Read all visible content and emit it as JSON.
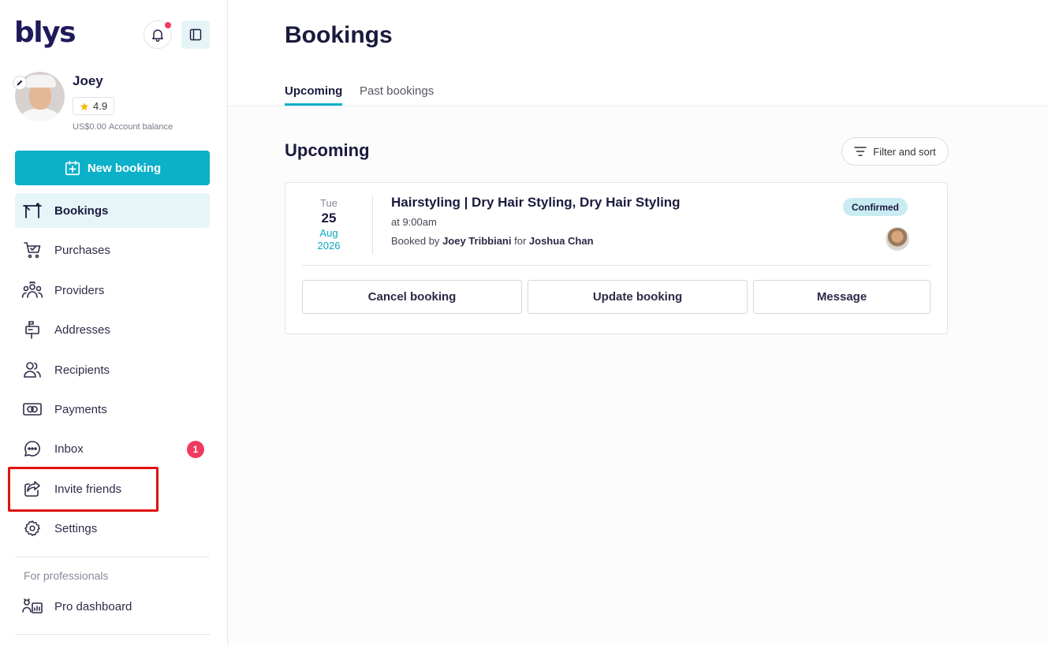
{
  "app": {
    "logo": "blys"
  },
  "profile": {
    "name": "Joey",
    "rating": "4.9",
    "balance_amount": "US$0.00",
    "balance_label": "Account balance"
  },
  "sidebar": {
    "new_booking_label": "New booking",
    "items": [
      {
        "label": "Bookings",
        "icon": "bookings-icon",
        "active": true
      },
      {
        "label": "Purchases",
        "icon": "cart-icon"
      },
      {
        "label": "Providers",
        "icon": "providers-icon"
      },
      {
        "label": "Addresses",
        "icon": "mailbox-icon"
      },
      {
        "label": "Recipients",
        "icon": "recipients-icon"
      },
      {
        "label": "Payments",
        "icon": "payments-icon"
      },
      {
        "label": "Inbox",
        "icon": "chat-icon",
        "badge": "1"
      },
      {
        "label": "Invite friends",
        "icon": "share-icon"
      },
      {
        "label": "Settings",
        "icon": "gear-icon"
      }
    ],
    "professionals_label": "For professionals",
    "pro_dashboard_label": "Pro dashboard"
  },
  "main": {
    "title": "Bookings",
    "tabs": [
      {
        "label": "Upcoming",
        "active": true
      },
      {
        "label": "Past bookings"
      }
    ],
    "section_title": "Upcoming",
    "filter_label": "Filter and sort",
    "booking": {
      "dow": "Tue",
      "day": "25",
      "month": "Aug",
      "year": "2026",
      "title": "Hairstyling | Dry Hair Styling, Dry Hair Styling",
      "time": "at 9:00am",
      "booked_by_prefix": "Booked by",
      "booked_by": "Joey Tribbiani",
      "for_word": "for",
      "recipient": "Joshua Chan",
      "status": "Confirmed",
      "actions": {
        "cancel": "Cancel booking",
        "update": "Update booking",
        "message": "Message"
      }
    }
  },
  "colors": {
    "brand": "#0bb0c9",
    "navy": "#1a1a3e",
    "badge": "#f03a5f",
    "highlight": "#e01010"
  }
}
